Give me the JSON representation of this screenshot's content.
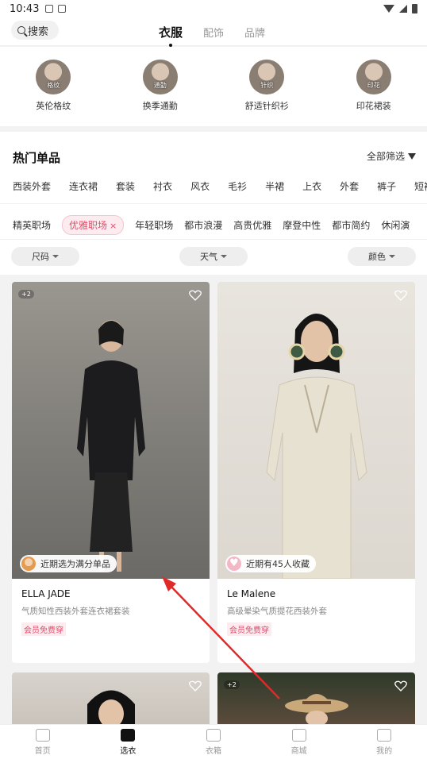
{
  "status_bar": {
    "time": "10:43"
  },
  "header": {
    "search_label": "搜索",
    "tabs": [
      {
        "label": "衣服",
        "active": true
      },
      {
        "label": "配饰",
        "active": false
      },
      {
        "label": "品牌",
        "active": false
      }
    ]
  },
  "categories": [
    {
      "label": "英伦格纹",
      "avatar_tag": "格纹"
    },
    {
      "label": "换季通勤",
      "avatar_tag": "通勤"
    },
    {
      "label": "舒适针织衫",
      "avatar_tag": "针织"
    },
    {
      "label": "印花裙装",
      "avatar_tag": "印花"
    }
  ],
  "hot": {
    "title": "热门单品",
    "filter_all": "全部筛选",
    "types": [
      "西装外套",
      "连衣裙",
      "套装",
      "衬衣",
      "风衣",
      "毛衫",
      "半裙",
      "上衣",
      "外套",
      "裤子",
      "短裤"
    ],
    "styles": [
      {
        "label": "精英职场",
        "selected": false
      },
      {
        "label": "优雅职场",
        "selected": true
      },
      {
        "label": "年轻职场",
        "selected": false
      },
      {
        "label": "都市浪漫",
        "selected": false
      },
      {
        "label": "高贵优雅",
        "selected": false
      },
      {
        "label": "摩登中性",
        "selected": false
      },
      {
        "label": "都市简约",
        "selected": false
      },
      {
        "label": "休闲演",
        "selected": false
      }
    ],
    "selects": {
      "size": "尺码",
      "weather": "天气",
      "color": "颜色"
    }
  },
  "products": [
    {
      "brand": "ELLA JADE",
      "desc": "气质知性西装外套连衣裙套装",
      "member": "会员免费穿",
      "note": "近期选为满分单品",
      "count_badge": "+2"
    },
    {
      "brand": "Le Malene",
      "desc": "高级晕染气质提花西装外套",
      "member": "会员免费穿",
      "note": "近期有45人收藏",
      "count_badge": ""
    },
    {
      "brand": "",
      "desc": "",
      "member": "",
      "note": "",
      "count_badge": ""
    },
    {
      "brand": "",
      "desc": "",
      "member": "",
      "note": "",
      "count_badge": "+2"
    }
  ],
  "tabbar": [
    {
      "label": "首页",
      "icon": "home-icon",
      "active": false
    },
    {
      "label": "选衣",
      "icon": "shirt-icon",
      "active": true
    },
    {
      "label": "衣箱",
      "icon": "box-icon",
      "active": false
    },
    {
      "label": "商城",
      "icon": "store-icon",
      "active": false
    },
    {
      "label": "我的",
      "icon": "profile-icon",
      "active": false
    }
  ],
  "colors": {
    "accent": "#e04d6c",
    "arrow": "#e02a2a"
  }
}
